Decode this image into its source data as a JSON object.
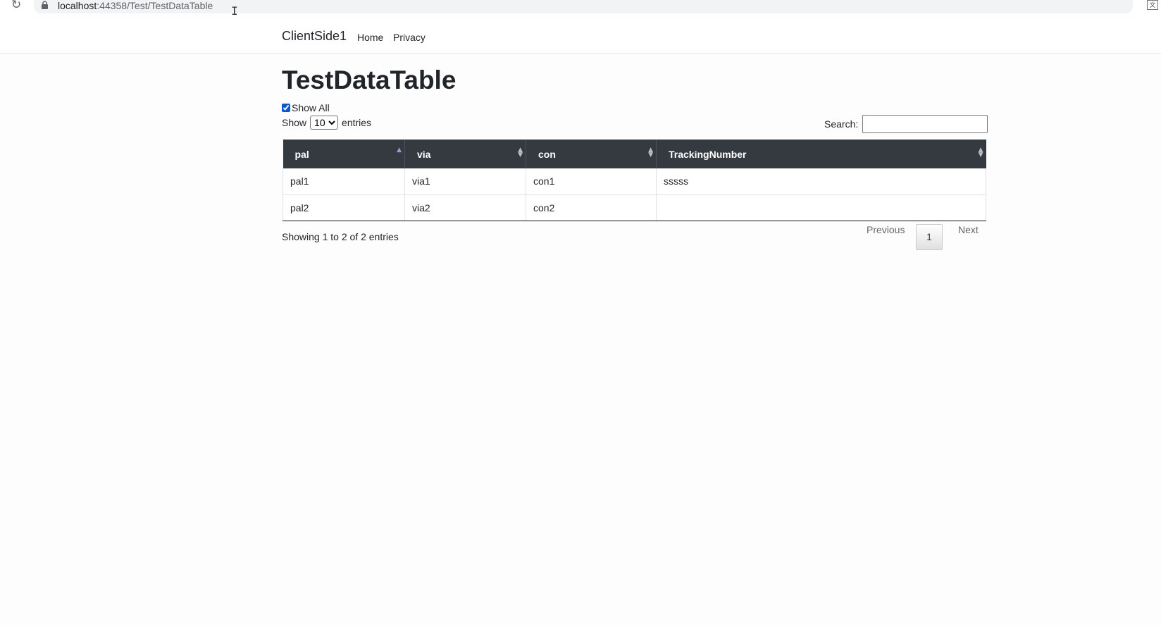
{
  "browser": {
    "url_host": "localhost",
    "url_rest": ":44358/Test/TestDataTable"
  },
  "navbar": {
    "brand": "ClientSide1",
    "links": [
      "Home",
      "Privacy"
    ]
  },
  "page": {
    "title": "TestDataTable",
    "show_all_label": "Show All",
    "show_all_checked": true,
    "length_prefix": "Show",
    "length_value": "10",
    "length_suffix": "entries",
    "search_label": "Search:",
    "search_value": ""
  },
  "table": {
    "columns": [
      "pal",
      "via",
      "con",
      "TrackingNumber"
    ],
    "sorted_column": "pal",
    "rows": [
      [
        "pal1",
        "via1",
        "con1",
        "sssss"
      ],
      [
        "pal2",
        "via2",
        "con2",
        ""
      ]
    ]
  },
  "footer": {
    "info": "Showing 1 to 2 of 2 entries",
    "previous": "Previous",
    "page": "1",
    "next": "Next"
  }
}
